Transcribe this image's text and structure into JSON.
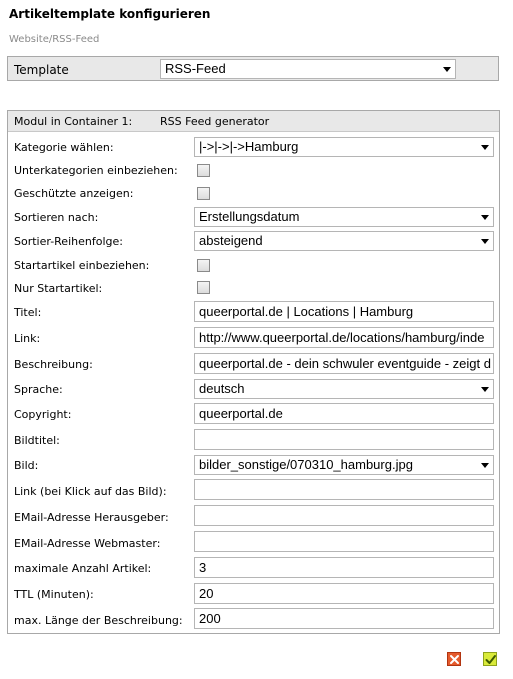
{
  "header": {
    "title": "Artikeltemplate konfigurieren",
    "breadcrumb": "Website/RSS-Feed"
  },
  "template": {
    "label": "Template",
    "selected": "RSS-Feed"
  },
  "module": {
    "header_label": "Modul in Container 1:",
    "header_value": "RSS Feed generator",
    "fields": {
      "kategorie": {
        "label": "Kategorie wählen:",
        "value": "|->|->|->Hamburg"
      },
      "unterkategorien": {
        "label": "Unterkategorien einbeziehen:",
        "checked": false
      },
      "geschuetzte": {
        "label": "Geschützte anzeigen:",
        "checked": false
      },
      "sortieren": {
        "label": "Sortieren nach:",
        "value": "Erstellungsdatum"
      },
      "reihenfolge": {
        "label": "Sortier-Reihenfolge:",
        "value": "absteigend"
      },
      "startartikel": {
        "label": "Startartikel einbeziehen:",
        "checked": false
      },
      "nur_startartikel": {
        "label": "Nur Startartikel:",
        "checked": false
      },
      "titel": {
        "label": "Titel:",
        "value": "queerportal.de | Locations | Hamburg"
      },
      "link": {
        "label": "Link:",
        "value": "http://www.queerportal.de/locations/hamburg/inde"
      },
      "beschreibung": {
        "label": "Beschreibung:",
        "value": "queerportal.de - dein schwuler eventguide - zeigt d"
      },
      "sprache": {
        "label": "Sprache:",
        "value": "deutsch"
      },
      "copyright": {
        "label": "Copyright:",
        "value": "queerportal.de"
      },
      "bildtitel": {
        "label": "Bildtitel:",
        "value": ""
      },
      "bild": {
        "label": "Bild:",
        "value": "bilder_sonstige/070310_hamburg.jpg"
      },
      "bildlink": {
        "label": "Link (bei Klick auf das Bild):",
        "value": ""
      },
      "email_herausgeber": {
        "label": "EMail-Adresse Herausgeber:",
        "value": ""
      },
      "email_webmaster": {
        "label": "EMail-Adresse Webmaster:",
        "value": ""
      },
      "max_artikel": {
        "label": "maximale Anzahl Artikel:",
        "value": "3"
      },
      "ttl": {
        "label": "TTL (Minuten):",
        "value": "20"
      },
      "max_laenge": {
        "label": "max. Länge der Beschreibung:",
        "value": "200"
      }
    }
  },
  "actions": {
    "cancel_icon": "close-icon",
    "ok_icon": "checkmark-icon",
    "cancel_color": "#e45a2c",
    "ok_color": "#d9ea3a"
  }
}
